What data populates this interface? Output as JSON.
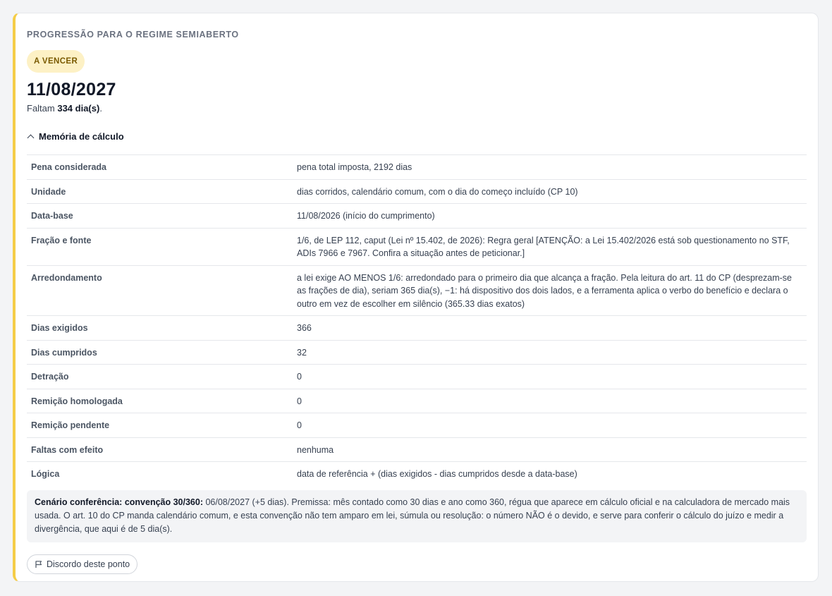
{
  "card": {
    "title": "PROGRESSÃO PARA O REGIME SEMIABERTO",
    "status_badge": "A VENCER",
    "date": "11/08/2027",
    "remaining_prefix": "Faltam ",
    "remaining_days": "334 dia(s)",
    "remaining_suffix": ".",
    "accent_color": "#f5cd47",
    "badge_bg": "#fdf1c5"
  },
  "memoria": {
    "toggle_label": "Memória de cálculo",
    "toggle_icon": "chevron-up-icon",
    "rows": [
      {
        "key": "Pena considerada",
        "value": "pena total imposta, 2192 dias"
      },
      {
        "key": "Unidade",
        "value": "dias corridos, calendário comum, com o dia do começo incluído (CP 10)"
      },
      {
        "key": "Data-base",
        "value": "11/08/2026 (início do cumprimento)"
      },
      {
        "key": "Fração e fonte",
        "value": "1/6, de LEP 112, caput (Lei nº 15.402, de 2026): Regra geral [ATENÇÃO: a Lei 15.402/2026 está sob questionamento no STF, ADIs 7966 e 7967. Confira a situação antes de peticionar.]"
      },
      {
        "key": "Arredondamento",
        "value": "a lei exige AO MENOS 1/6: arredondado para o primeiro dia que alcança a fração. Pela leitura do art. 11 do CP (desprezam-se as frações de dia), seriam 365 dia(s), −1: há dispositivo dos dois lados, e a ferramenta aplica o verbo do benefício e declara o outro em vez de escolher em silêncio (365.33 dias exatos)"
      },
      {
        "key": "Dias exigidos",
        "value": "366"
      },
      {
        "key": "Dias cumpridos",
        "value": "32"
      },
      {
        "key": "Detração",
        "value": "0"
      },
      {
        "key": "Remição homologada",
        "value": "0"
      },
      {
        "key": "Remição pendente",
        "value": "0"
      },
      {
        "key": "Faltas com efeito",
        "value": "nenhuma"
      },
      {
        "key": "Lógica",
        "value": "data de referência + (dias exigidos - dias cumpridos desde a data-base)"
      }
    ]
  },
  "scenario": {
    "label": "Cenário conferência: convenção 30/360:",
    "text": " 06/08/2027 (+5 dias). Premissa: mês contado como 30 dias e ano como 360, régua que aparece em cálculo oficial e na calculadora de mercado mais usada. O art. 10 do CP manda calendário comum, e esta convenção não tem amparo em lei, súmula ou resolução: o número NÃO é o devido, e serve para conferir o cálculo do juízo e medir a divergência, que aqui é de 5 dia(s)."
  },
  "actions": {
    "discord_label": "Discordo deste ponto",
    "discord_icon": "flag-icon"
  }
}
